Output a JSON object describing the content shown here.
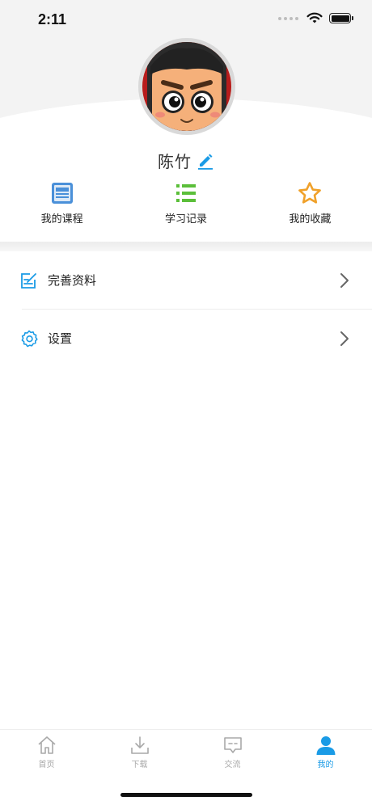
{
  "status_bar": {
    "time": "2:11"
  },
  "profile": {
    "username": "陈竹",
    "icons": {
      "avatar": "cartoon-avatar",
      "edit": "pencil-icon"
    }
  },
  "quick_actions": [
    {
      "label": "我的课程",
      "icon": "course-icon",
      "color": "#4a90d9"
    },
    {
      "label": "学习记录",
      "icon": "list-icon",
      "color": "#5bbf3a"
    },
    {
      "label": "我的收藏",
      "icon": "star-icon",
      "color": "#f0a12a"
    }
  ],
  "menu": [
    {
      "label": "完善资料",
      "icon": "edit-profile-icon"
    },
    {
      "label": "设置",
      "icon": "gear-icon"
    }
  ],
  "tabbar": {
    "active": "我的",
    "tabs": [
      {
        "label": "首页",
        "icon": "home-icon"
      },
      {
        "label": "下载",
        "icon": "download-icon"
      },
      {
        "label": "交流",
        "icon": "chat-icon"
      },
      {
        "label": "我的",
        "icon": "user-icon"
      }
    ]
  },
  "colors": {
    "accent": "#1a9be6",
    "inactive": "#a9a9a9"
  }
}
